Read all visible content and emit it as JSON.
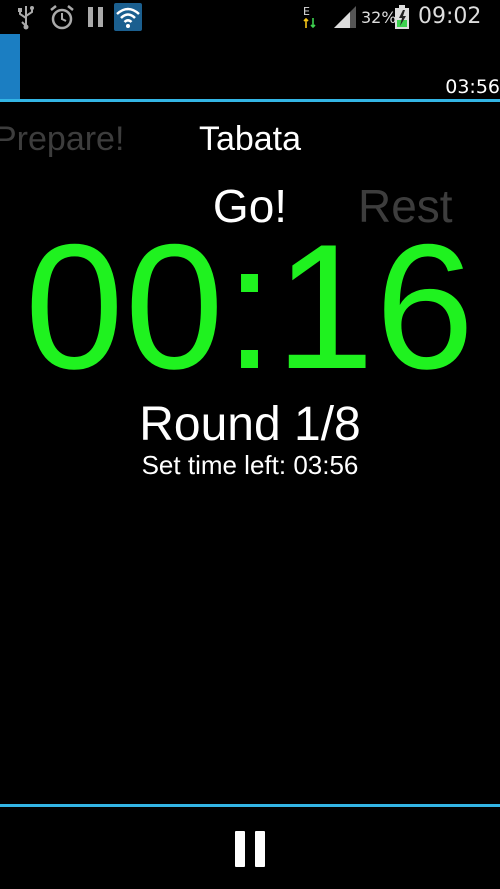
{
  "status_bar": {
    "battery_percent": "32%",
    "clock": "09:02",
    "network_type": "E",
    "icons": [
      "usb-icon",
      "alarm-icon",
      "pause-icon",
      "wifi-icon",
      "edge-data-icon",
      "signal-icon",
      "battery-charging-icon"
    ]
  },
  "progress": {
    "time_left": "03:56",
    "fraction_elapsed": 0.04
  },
  "phases": {
    "previous": "Prepare!",
    "current": "Go!",
    "next": "Rest"
  },
  "workout_name": "Tabata",
  "timer": "00:16",
  "round": "Round 1/8",
  "set_time_left": "Set time left: 03:56",
  "controls": {
    "pause_icon": "pause-icon"
  },
  "colors": {
    "timer": "#1ff21f",
    "accent": "#33b5e5",
    "progress_fill": "#1b7ec2",
    "inactive_phase": "#3d3d3d"
  }
}
